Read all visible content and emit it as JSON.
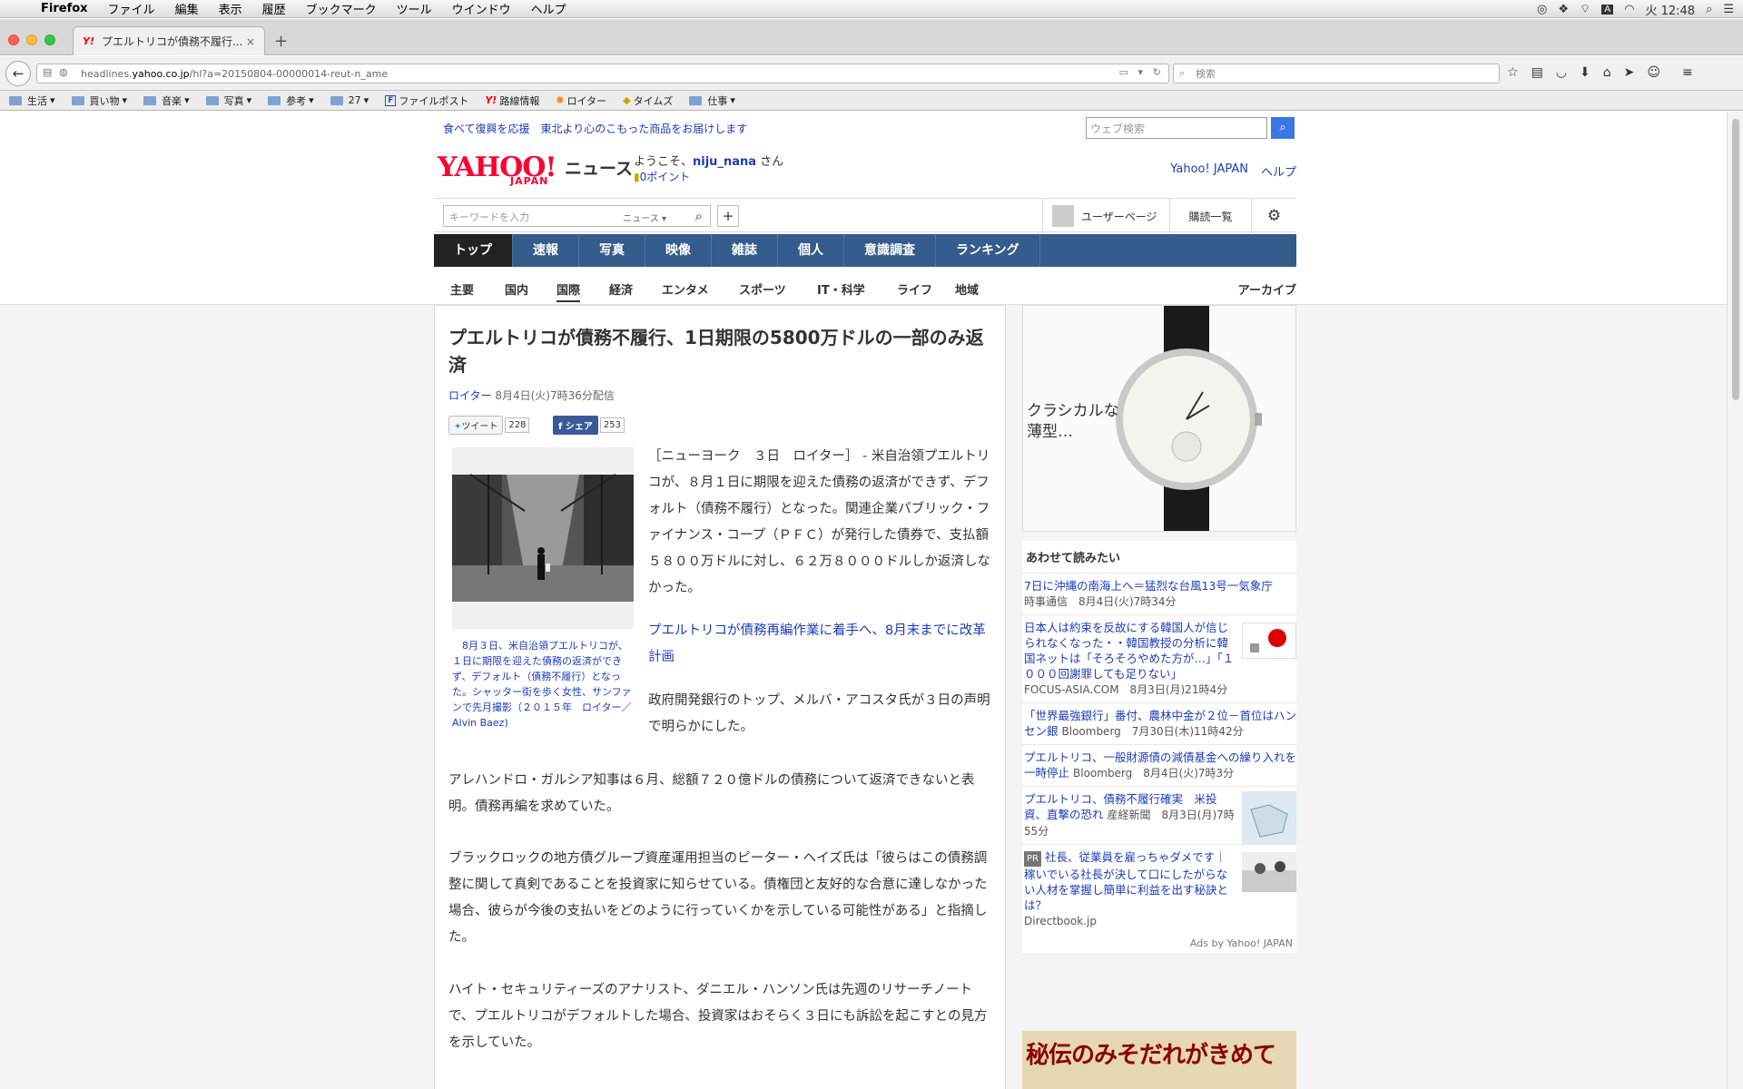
{
  "menubar": {
    "apple": "",
    "app": "Firefox",
    "items": [
      "ファイル",
      "編集",
      "表示",
      "履歴",
      "ブックマーク",
      "ツール",
      "ウインドウ",
      "ヘルプ"
    ],
    "clock": "火 12:48"
  },
  "tab": {
    "title": "プエルトリコが債務不履行...",
    "favicon": "Y!"
  },
  "urlbar": {
    "prefix": "headlines.",
    "host": "yahoo.co.jp",
    "path": "/hl?a=20150804-00000014-reut-n_ame"
  },
  "searchbar": {
    "placeholder": "検索"
  },
  "bookmarks": [
    "生活",
    "買い物",
    "音楽",
    "写真",
    "参考",
    "27",
    "ファイルポスト",
    "路線情報",
    "ロイター",
    "タイムズ",
    "仕事"
  ],
  "page": {
    "promo": "食べて復興を応援　東北より心のこもった商品をお届けします",
    "websearch_placeholder": "ウェブ検索",
    "logo": "YAHOO!",
    "logo_japan": "JAPAN",
    "logo_news": "ニュース",
    "welcome_pre": "ようこそ、",
    "username": "niju_nana",
    "welcome_post": " さん",
    "points": "0ポイント",
    "header_links": [
      "Yahoo! JAPAN",
      "ヘルプ"
    ],
    "keyword_placeholder": "キーワードを入力",
    "keyword_scope": "ニュース ▾",
    "user_page": "ユーザーページ",
    "subscriptions": "購読一覧",
    "main_nav": [
      "トップ",
      "速報",
      "写真",
      "映像",
      "雑誌",
      "個人",
      "意識調査",
      "ランキング"
    ],
    "sub_nav": [
      "主要",
      "国内",
      "国際",
      "経済",
      "エンタメ",
      "スポーツ",
      "IT・科学",
      "ライフ",
      "地域"
    ],
    "archive": "アーカイブ"
  },
  "article": {
    "title": "プエルトリコが債務不履行、1日期限の5800万ドルの一部のみ返済",
    "source": "ロイター",
    "date": " 8月4日(火)7時36分配信",
    "tweet_label": "ツイート",
    "tweet_count": "228",
    "share_label": "シェア",
    "share_count": "253",
    "photo_caption": "　8月３日、米自治領プエルトリコが、１日に期限を迎えた債務の返済ができず、デフォルト（債務不履行）となった。シャッター街を歩く女性、サンファンで先月撮影（２０１５年　ロイター／Alvin Baez)",
    "body1": "［ニューヨーク　３日　ロイター］ - 米自治領プエルトリコが、８月１日に期限を迎えた債務の返済ができず、デフォルト（債務不履行）となった。関連企業パブリック・ファイナンス・コープ（ＰＦＣ）が発行した債券で、支払額５８００万ドルに対し、６２万８０００ドルしか返済しなかった。",
    "related_link": "プエルトリコが債務再編作業に着手へ、8月末までに改革計画",
    "body2": "政府開発銀行のトップ、メルバ・アコスタ氏が３日の声明で明らかにした。",
    "para1": "アレハンドロ・ガルシア知事は６月、総額７２０億ドルの債務について返済できないと表明。債務再編を求めていた。",
    "para2": "ブラックロックの地方債グループ資産運用担当のピーター・ヘイズ氏は「彼らはこの債務調整に関して真剣であることを投資家に知らせている。債権団と友好的な合意に達しなかった場合、彼らが今後の支払いをどのように行っていくかを示している可能性がある」と指摘した。",
    "para3": "ハイト・セキュリティーズのアナリスト、ダニエル・ハンソン氏は先週のリサーチノートで、プエルトリコがデフォルトした場合、投資家はおそらく３日にも訴訟を起こすとの見方を示していた。"
  },
  "sidebar": {
    "ad_text": "クラシカルな\n薄型…",
    "related_title": "あわせて読みたい",
    "related": [
      {
        "title": "7日に沖縄の南海上へ＝猛烈な台風13号一気象庁",
        "source": "時事通信　8月4日(火)7時34分"
      },
      {
        "title": "日本人は約束を反故にする韓国人が信じられなくなった・・韓国教授の分析に韓国ネットは「そろそろやめた方が…」「１０００回謝罪しても足りない」",
        "source": "FOCUS-ASIA.COM　8月3日(月)21時4分"
      },
      {
        "title": "「世界最強銀行」番付、農林中金が２位－首位はハンセン銀",
        "source": " Bloomberg　7月30日(木)11時42分"
      },
      {
        "title": "プエルトリコ、一般財源債の減債基金への繰り入れを一時停止",
        "source": " Bloomberg　8月4日(火)7時3分"
      },
      {
        "title": "プエルトリコ、債務不履行確実　米投資、直撃の恐れ",
        "source": " 産経新聞　8月3日(月)7時55分"
      }
    ],
    "pr_label": "PR",
    "pr_title": "社長、従業員を雇っちゃダメです｜稼いでいる社長が決して口にしたがらない人材を掌握し簡単に利益を出す秘訣とは？",
    "pr_source": "Directbook.jp",
    "ads_by": "Ads by Yahoo! JAPAN",
    "ad2_text": "秘伝のみそだれがきめて"
  }
}
